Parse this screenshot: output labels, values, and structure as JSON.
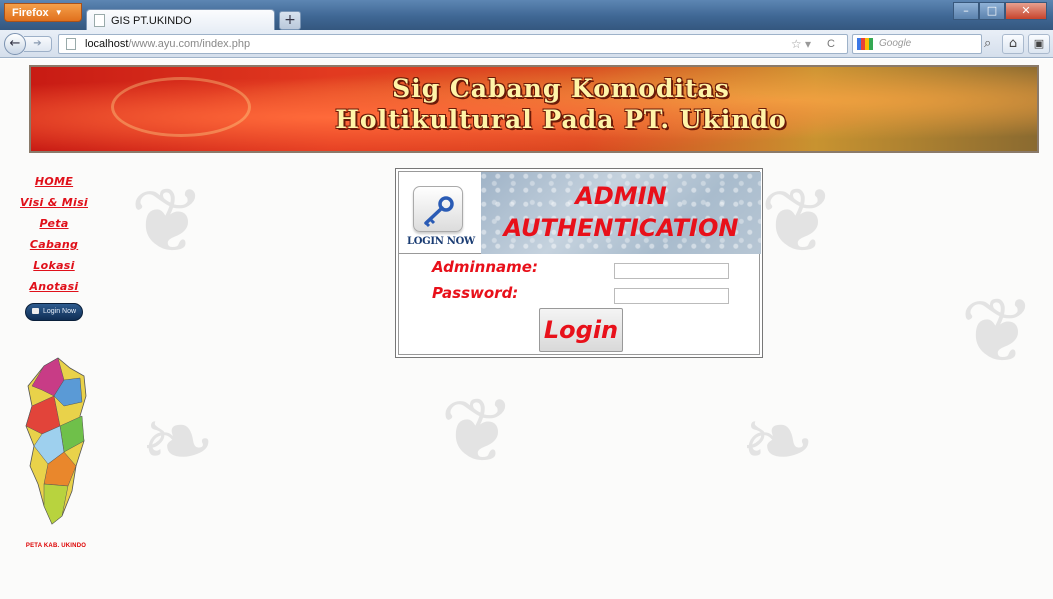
{
  "browser": {
    "app_button": "Firefox",
    "tab_title": "GIS PT.UKINDO",
    "url_host": "localhost",
    "url_path": "/www.ayu.com/index.php",
    "search_placeholder": "Google"
  },
  "banner": {
    "title_line1": "Sig Cabang Komoditas",
    "title_line2": "Holtikultural Pada PT. Ukindo"
  },
  "sidebar": {
    "items": [
      {
        "label": "HOME"
      },
      {
        "label": "Visi & Misi"
      },
      {
        "label": "Peta"
      },
      {
        "label": "Cabang"
      },
      {
        "label": "Lokasi"
      },
      {
        "label": "Anotasi"
      }
    ],
    "login_button": "Login Now",
    "map_caption": "PETA KAB. UKINDO"
  },
  "auth": {
    "icon_caption": "LOGIN NOW",
    "title_line1": "ADMIN",
    "title_line2": "AUTHENTICATION",
    "admin_label": "Adminname:",
    "password_label": "Password:",
    "admin_value": "",
    "password_value": "",
    "submit_label": "Login"
  },
  "colors": {
    "accent_red": "#e8101a",
    "banner_text": "#fff4a8"
  }
}
